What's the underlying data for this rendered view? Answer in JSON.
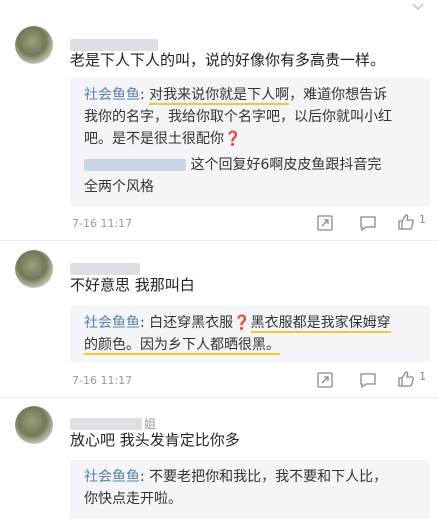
{
  "comments": [
    {
      "text": "老是下人下人的叫，说的好像你有多高贵一样。",
      "replies": {
        "r1_name": "社会鱼鱼",
        "r1_a": ": ",
        "r1_b": "对我来说你就是下人啊",
        "r1_c": "，难道你想告诉",
        "r1_l2": "我你的名字，我给你取个名字吧，以后你就叫小红",
        "r1_l3a": "吧。是不是很土很配你",
        "r1_q": "❓",
        "r2_l1": "这个回复好6啊皮皮鱼跟抖音完",
        "r2_l2": "全两个风格"
      },
      "time": "7-16 11:17",
      "like_count": "1"
    },
    {
      "text": "不好意思 我那叫白",
      "replies": {
        "r1_name": "社会鱼鱼",
        "r1_a": ": 白还穿黑衣服",
        "r1_q": "❓",
        "r1_b": "黑衣服都是我家保姆穿",
        "r1_l2": "的颜色。因为乡下人都晒很黑。"
      },
      "time": "7-16 11:17",
      "like_count": "1"
    },
    {
      "username_suffix": "姐",
      "text": "放心吧 我头发肯定比你多",
      "replies": {
        "r1_name": "社会鱼鱼",
        "r1_a": ": 不要老把你和我比，我不要和下人比，",
        "r1_l2": "你快点走开啦。"
      }
    }
  ],
  "icons": {
    "chevron": "chevron-down-icon",
    "share": "share-icon",
    "comment": "comment-icon",
    "like": "thumbs-up-icon"
  },
  "colors": {
    "reply_name": "#5b7ea6",
    "highlight_underline": "#f2c832",
    "question_mark": "#d9342b",
    "reply_bg": "#f3f5f8"
  }
}
